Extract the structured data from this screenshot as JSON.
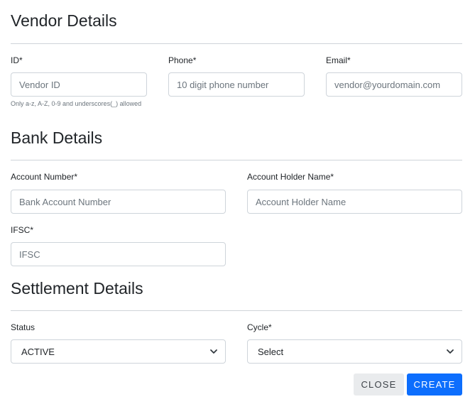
{
  "vendor_details": {
    "title": "Vendor Details",
    "id": {
      "label": "ID*",
      "placeholder": "Vendor ID",
      "hint": "Only a-z, A-Z, 0-9 and underscores(_) allowed"
    },
    "phone": {
      "label": "Phone*",
      "placeholder": "10 digit phone number"
    },
    "email": {
      "label": "Email*",
      "placeholder": "vendor@yourdomain.com"
    }
  },
  "bank_details": {
    "title": "Bank Details",
    "account_number": {
      "label": "Account Number*",
      "placeholder": "Bank Account Number"
    },
    "account_holder": {
      "label": "Account Holder Name*",
      "placeholder": "Account Holder Name"
    },
    "ifsc": {
      "label": "IFSC*",
      "placeholder": "IFSC"
    }
  },
  "settlement_details": {
    "title": "Settlement Details",
    "status": {
      "label": "Status",
      "selected": "ACTIVE"
    },
    "cycle": {
      "label": "Cycle*",
      "selected": "Select"
    }
  },
  "actions": {
    "close_label": "CLOSE",
    "create_label": "CREATE"
  },
  "icons": {
    "select_arrow": "chevron-down-icon"
  },
  "colors": {
    "primary": "#0d6efd",
    "secondary_bg": "#e9ebed",
    "border": "#ced4da",
    "text": "#212529",
    "muted": "#6c757d"
  }
}
